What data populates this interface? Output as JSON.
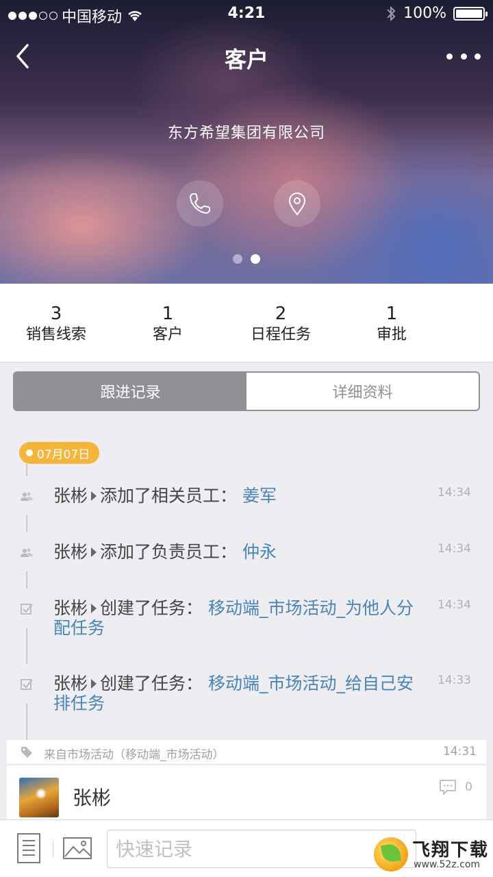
{
  "status_bar": {
    "carrier": "中国移动",
    "time": "4:21",
    "battery": "100%"
  },
  "nav": {
    "title": "客户"
  },
  "hero": {
    "company": "东方希望集团有限公司"
  },
  "stats": [
    {
      "value": "3",
      "label": "销售线索"
    },
    {
      "value": "1",
      "label": "客户"
    },
    {
      "value": "2",
      "label": "日程任务"
    },
    {
      "value": "1",
      "label": "审批"
    }
  ],
  "tabs": {
    "active": "跟进记录",
    "inactive": "详细资料"
  },
  "timeline": {
    "date": "07月07日",
    "entries": [
      {
        "who": "张彬",
        "action": "添加了相关员工：",
        "target": "姜军",
        "time": "14:34",
        "icon": "people-icon"
      },
      {
        "who": "张彬",
        "action": "添加了负责员工：",
        "target": "仲永",
        "time": "14:34",
        "icon": "people-icon"
      },
      {
        "who": "张彬",
        "action": "创建了任务：",
        "target": "移动端_市场活动_为他人分配任务",
        "time": "14:34",
        "icon": "task-check-icon"
      },
      {
        "who": "张彬",
        "action": "创建了任务：",
        "target": "移动端_市场活动_给自己安排任务",
        "time": "14:33",
        "icon": "task-check-icon"
      }
    ]
  },
  "card": {
    "source": "来自市场活动（移动端_市场活动）",
    "time": "14:31",
    "name": "张彬",
    "comment_count": "0"
  },
  "bottom_bar": {
    "placeholder": "快速记录"
  },
  "watermark": {
    "title": "飞翔下载",
    "url": "www.52z.com"
  },
  "colors": {
    "accent_link": "#4a84b8",
    "date_badge": "#f3b63a",
    "segment_active": "#8f8f94"
  }
}
